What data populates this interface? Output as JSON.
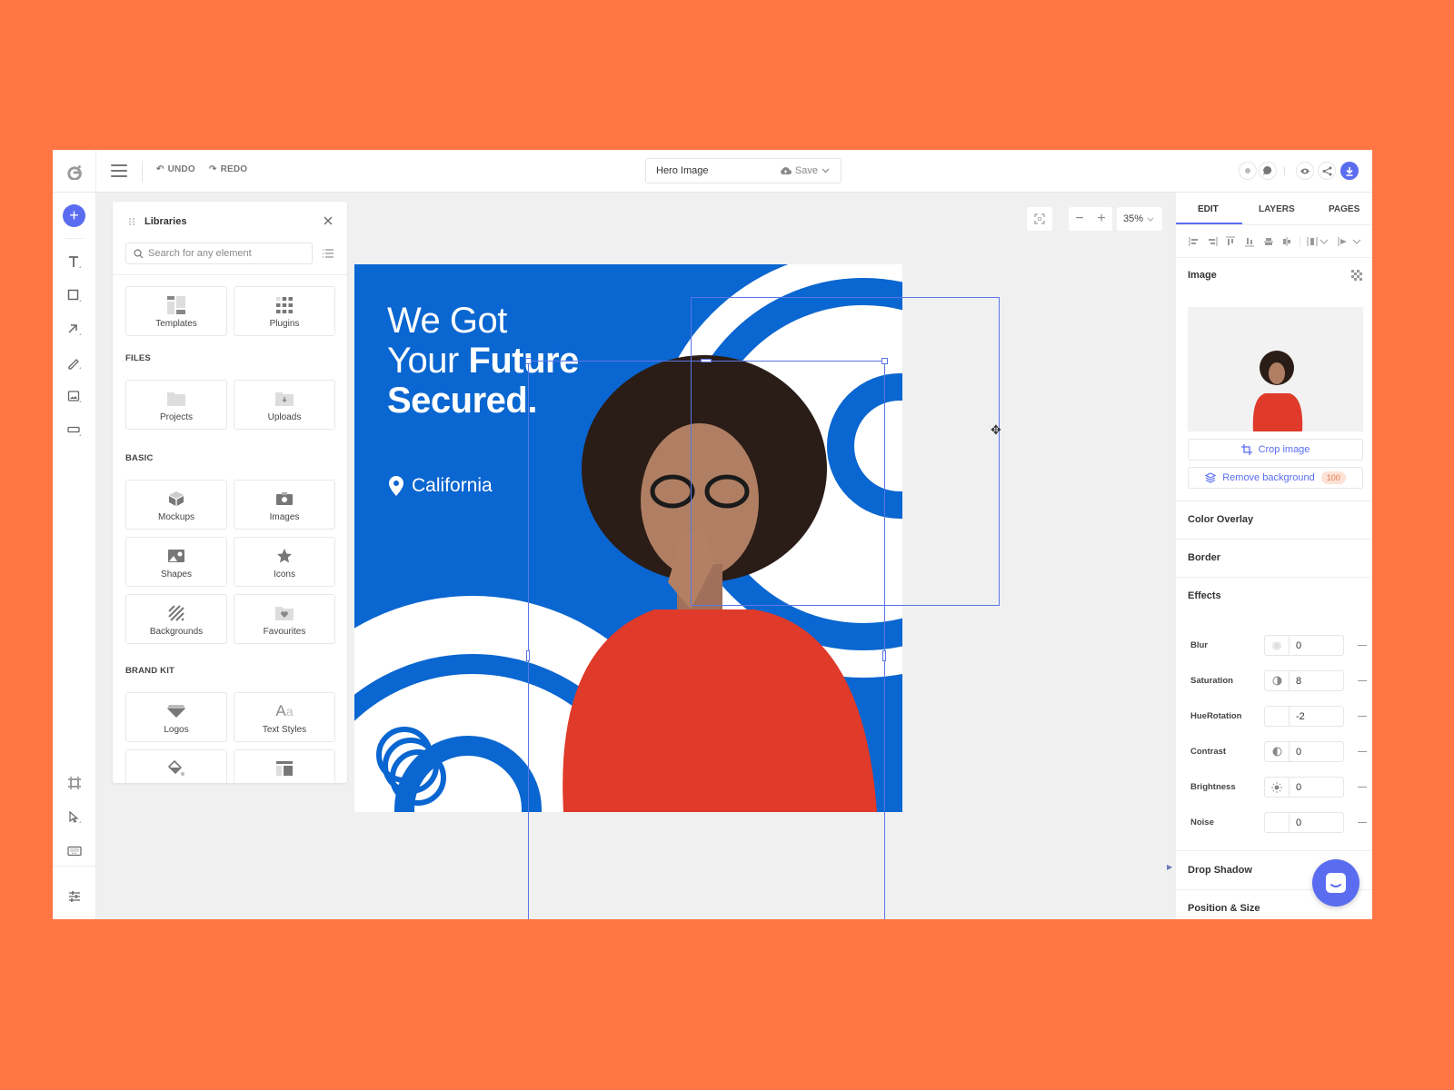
{
  "app": {
    "logo_icon": "g-logo-icon",
    "accent_color": "#5A6DF0",
    "background_color": "#FF7544"
  },
  "topbar": {
    "undo_label": "UNDO",
    "redo_label": "REDO",
    "document_title": "Hero Image",
    "save_label": "Save",
    "right_icons": [
      "record-icon",
      "comment-icon",
      "preview-eye-icon",
      "share-icon",
      "download-icon"
    ]
  },
  "left_tools": {
    "top": [
      "add-icon",
      "text-tool-icon",
      "rectangle-tool-icon",
      "arrow-tool-icon",
      "pen-tool-icon",
      "image-tool-icon",
      "button-tool-icon"
    ],
    "bottom": [
      "artboard-icon",
      "pointer-icon",
      "keyboard-icon",
      "settings-sliders-icon"
    ]
  },
  "libraries": {
    "title": "Libraries",
    "search_placeholder": "Search for any element",
    "top_items": [
      {
        "label": "Templates",
        "icon": "templates-icon"
      },
      {
        "label": "Plugins",
        "icon": "plugins-icon"
      }
    ],
    "sections": [
      {
        "title": "FILES",
        "items": [
          {
            "label": "Projects",
            "icon": "folder-icon"
          },
          {
            "label": "Uploads",
            "icon": "upload-folder-icon"
          }
        ]
      },
      {
        "title": "BASIC",
        "items": [
          {
            "label": "Mockups",
            "icon": "cube-icon"
          },
          {
            "label": "Images",
            "icon": "camera-icon"
          },
          {
            "label": "Shapes",
            "icon": "picture-icon"
          },
          {
            "label": "Icons",
            "icon": "star-icon"
          },
          {
            "label": "Backgrounds",
            "icon": "stripes-icon"
          },
          {
            "label": "Favourites",
            "icon": "heart-folder-icon"
          }
        ]
      },
      {
        "title": "BRAND KIT",
        "items": [
          {
            "label": "Logos",
            "icon": "diamond-icon"
          },
          {
            "label": "Text Styles",
            "icon": "text-styles-icon"
          },
          {
            "label": "",
            "icon": "paint-bucket-icon"
          },
          {
            "label": "",
            "icon": "layout-icon"
          }
        ]
      }
    ]
  },
  "canvas": {
    "zoom": "35%",
    "artboard_color": "#0A66D0",
    "headline": {
      "line1": "We Got",
      "line2_light": "Your ",
      "line2_bold": "Future",
      "line3": "Secured."
    },
    "location": "California"
  },
  "right_panel": {
    "tabs": [
      "EDIT",
      "LAYERS",
      "PAGES"
    ],
    "active_tab": "EDIT",
    "image_section_title": "Image",
    "crop_label": "Crop image",
    "remove_bg_label": "Remove background",
    "remove_bg_credits": "100",
    "sections": [
      "Color Overlay",
      "Border",
      "Effects"
    ],
    "effects": [
      {
        "name": "Blur",
        "value": "0",
        "icon": "blur-icon"
      },
      {
        "name": "Saturation",
        "value": "8",
        "icon": "saturation-icon"
      },
      {
        "name": "HueRotation",
        "value": "-2",
        "icon": ""
      },
      {
        "name": "Contrast",
        "value": "0",
        "icon": "contrast-icon"
      },
      {
        "name": "Brightness",
        "value": "0",
        "icon": "brightness-icon"
      },
      {
        "name": "Noise",
        "value": "0",
        "icon": ""
      }
    ],
    "drop_shadow": "Drop Shadow",
    "position_size": "Position & Size"
  }
}
